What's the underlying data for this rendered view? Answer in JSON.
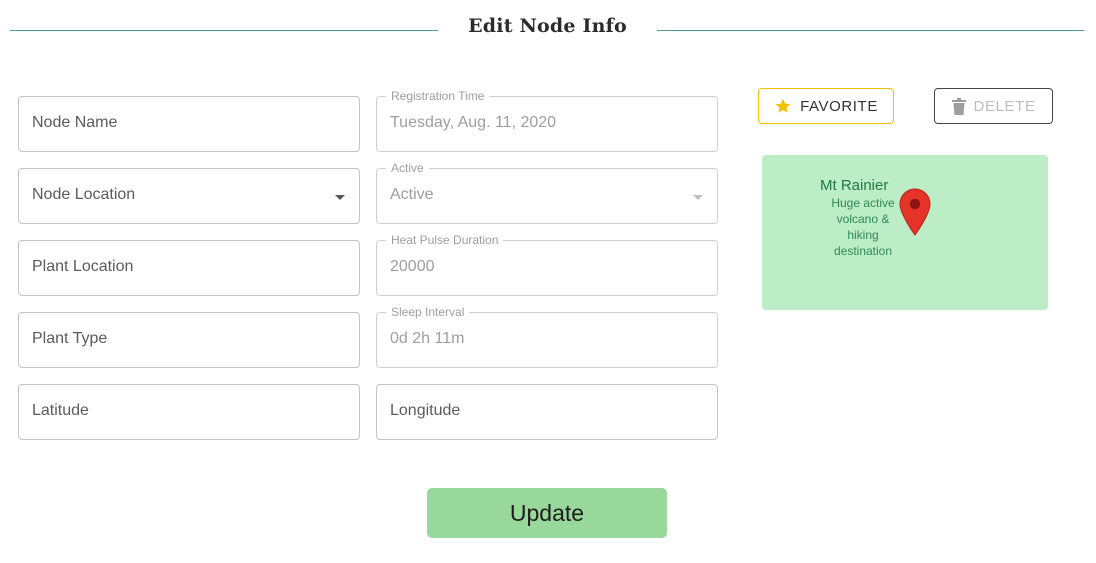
{
  "header": {
    "title": "Edit Node Info"
  },
  "form": {
    "node_name": {
      "placeholder": "Node Name"
    },
    "node_location": {
      "placeholder": "Node Location"
    },
    "plant_location": {
      "placeholder": "Plant Location"
    },
    "plant_type": {
      "placeholder": "Plant Type"
    },
    "latitude": {
      "placeholder": "Latitude"
    },
    "longitude": {
      "placeholder": "Longitude"
    },
    "registration_time": {
      "label": "Registration Time",
      "value": "Tuesday, Aug. 11, 2020"
    },
    "active": {
      "label": "Active",
      "value": "Active"
    },
    "heat_pulse_duration": {
      "label": "Heat Pulse Duration",
      "value": "20000"
    },
    "sleep_interval": {
      "label": "Sleep Interval",
      "value": "0d 2h 11m"
    }
  },
  "actions": {
    "favorite_label": "FAVORITE",
    "delete_label": "DELETE",
    "update_label": "Update"
  },
  "map": {
    "place_name": "Mt Rainier",
    "description": "Huge active volcano & hiking destination"
  },
  "colors": {
    "header_rule": "#4f9a91",
    "favorite_border": "#f2c200",
    "favorite_star": "#f2c200",
    "map_bg": "#bdedc6",
    "pin": "#e5332a",
    "update_bg": "#98d89a"
  },
  "icons": {
    "favorite": "star-icon",
    "delete": "trash-icon",
    "map_marker": "map-pin-icon",
    "select": "caret-down-icon"
  }
}
